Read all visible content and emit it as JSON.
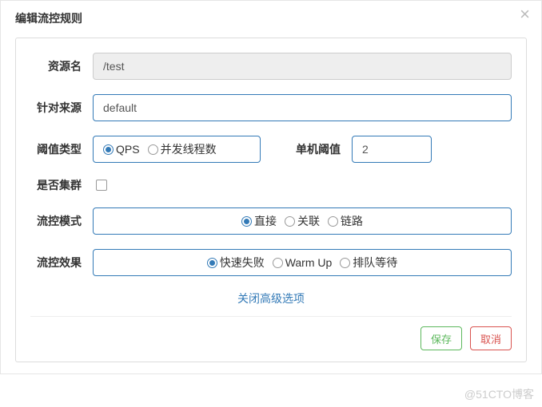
{
  "header": {
    "title": "编辑流控规则"
  },
  "form": {
    "resource": {
      "label": "资源名",
      "value": "/test"
    },
    "limit_app": {
      "label": "针对来源",
      "value": "default"
    },
    "threshold_type": {
      "label": "阈值类型",
      "options": {
        "qps": "QPS",
        "thread": "并发线程数"
      },
      "selected": "qps"
    },
    "single_threshold": {
      "label": "单机阈值",
      "value": "2"
    },
    "cluster": {
      "label": "是否集群"
    },
    "mode": {
      "label": "流控模式",
      "options": {
        "direct": "直接",
        "relate": "关联",
        "chain": "链路"
      },
      "selected": "direct"
    },
    "effect": {
      "label": "流控效果",
      "options": {
        "fail_fast": "快速失败",
        "warm_up": "Warm Up",
        "queue": "排队等待"
      },
      "selected": "fail_fast"
    }
  },
  "collapse_link": "关闭高级选项",
  "footer": {
    "save": "保存",
    "cancel": "取消"
  },
  "watermark": "@51CTO博客"
}
